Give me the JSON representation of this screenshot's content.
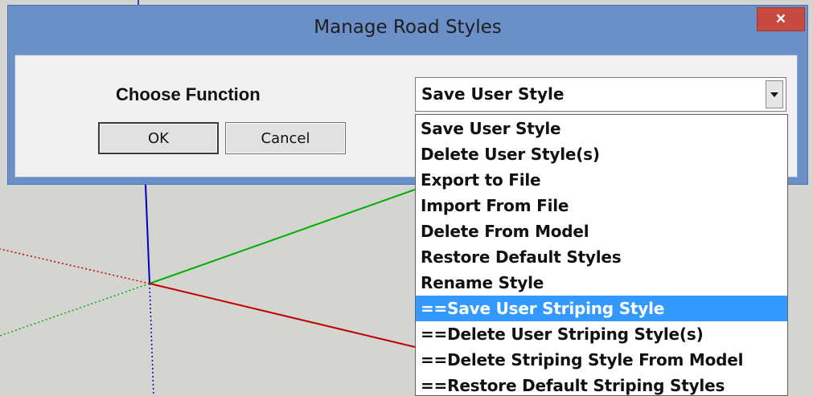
{
  "dialog": {
    "title": "Manage Road Styles",
    "close_glyph": "×",
    "choose_label": "Choose Function",
    "ok_label": "OK",
    "cancel_label": "Cancel"
  },
  "dropdown": {
    "selected": "Save User Style",
    "arrow_icon": "triangle-down",
    "highlighted_index": 7,
    "options": [
      "Save User Style",
      "Delete User Style(s)",
      "Export to File",
      "Import From File",
      "Delete From Model",
      "Restore Default Styles",
      "Rename Style",
      "==Save User Striping Style",
      "==Delete User Striping Style(s)",
      "==Delete Striping Style From Model",
      "==Restore Default Striping Styles"
    ]
  },
  "colors": {
    "title_bar": "#6b90c7",
    "close_button": "#c74a40",
    "highlight": "#3399ff",
    "axis_red": "#c00000",
    "axis_green": "#00b000",
    "axis_blue": "#0000c0"
  }
}
